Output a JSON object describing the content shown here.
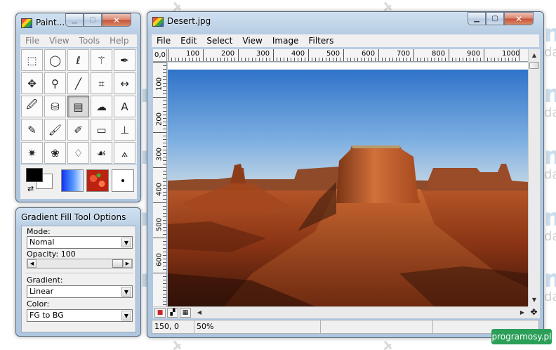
{
  "watermark": {
    "brand": "m",
    "fragment": "daw"
  },
  "tools_window": {
    "title": "Paint...",
    "menu": [
      "File",
      "View",
      "Tools",
      "Help"
    ],
    "tools": [
      {
        "name": "rect-select-icon",
        "glyph": "⬚"
      },
      {
        "name": "ellipse-select-icon",
        "glyph": "◯"
      },
      {
        "name": "lasso-select-icon",
        "glyph": "ℓ"
      },
      {
        "name": "magic-wand-icon",
        "glyph": "⚚"
      },
      {
        "name": "bezier-pen-icon",
        "glyph": "✒"
      },
      {
        "name": "move-icon",
        "glyph": "✥"
      },
      {
        "name": "zoom-icon",
        "glyph": "⚲"
      },
      {
        "name": "pencil-line-icon",
        "glyph": "╱"
      },
      {
        "name": "crop-icon",
        "glyph": "⌗"
      },
      {
        "name": "flip-icon",
        "glyph": "↔"
      },
      {
        "name": "eyedropper-icon",
        "glyph": "🖉"
      },
      {
        "name": "paint-bucket-icon",
        "glyph": "⛁"
      },
      {
        "name": "gradient-icon",
        "glyph": "▤"
      },
      {
        "name": "smudge-icon",
        "glyph": "☁"
      },
      {
        "name": "text-icon",
        "glyph": "A"
      },
      {
        "name": "pencil-icon",
        "glyph": "✎"
      },
      {
        "name": "brush-icon",
        "glyph": "🖌"
      },
      {
        "name": "airbrush-icon",
        "glyph": "✐"
      },
      {
        "name": "eraser-icon",
        "glyph": "▭"
      },
      {
        "name": "clone-stamp-icon",
        "glyph": "⊥"
      },
      {
        "name": "effects-icon",
        "glyph": "✷"
      },
      {
        "name": "palette-icon",
        "glyph": "❀"
      },
      {
        "name": "blur-drop-icon",
        "glyph": "♢"
      },
      {
        "name": "smear-icon",
        "glyph": "☙"
      },
      {
        "name": "measure-icon",
        "glyph": "⟑"
      }
    ],
    "active_tool_index": 12,
    "fg_color": "#000000",
    "bg_color": "#ffffff"
  },
  "options_window": {
    "title": "Gradient Fill Tool Options",
    "mode_label": "Mode:",
    "mode_value": "Nomal",
    "opacity_label": "Opacity: 100",
    "opacity": 100,
    "gradient_label": "Gradient:",
    "gradient_value": "Linear",
    "color_label": "Color:",
    "color_value": "FG to BG"
  },
  "image_window": {
    "title": "Desert.jpg",
    "menu": [
      "File",
      "Edit",
      "Select",
      "View",
      "Image",
      "Filters"
    ],
    "origin_label": "0,0",
    "ruler_top_labels": [
      "100",
      "200",
      "300",
      "400",
      "500",
      "600",
      "700",
      "800",
      "900",
      "1000"
    ],
    "ruler_left_labels": [
      "100",
      "200",
      "300",
      "400",
      "500",
      "600"
    ],
    "status_coords": "150, 0",
    "status_zoom": "50%"
  },
  "badge_text": "programosy.pl"
}
